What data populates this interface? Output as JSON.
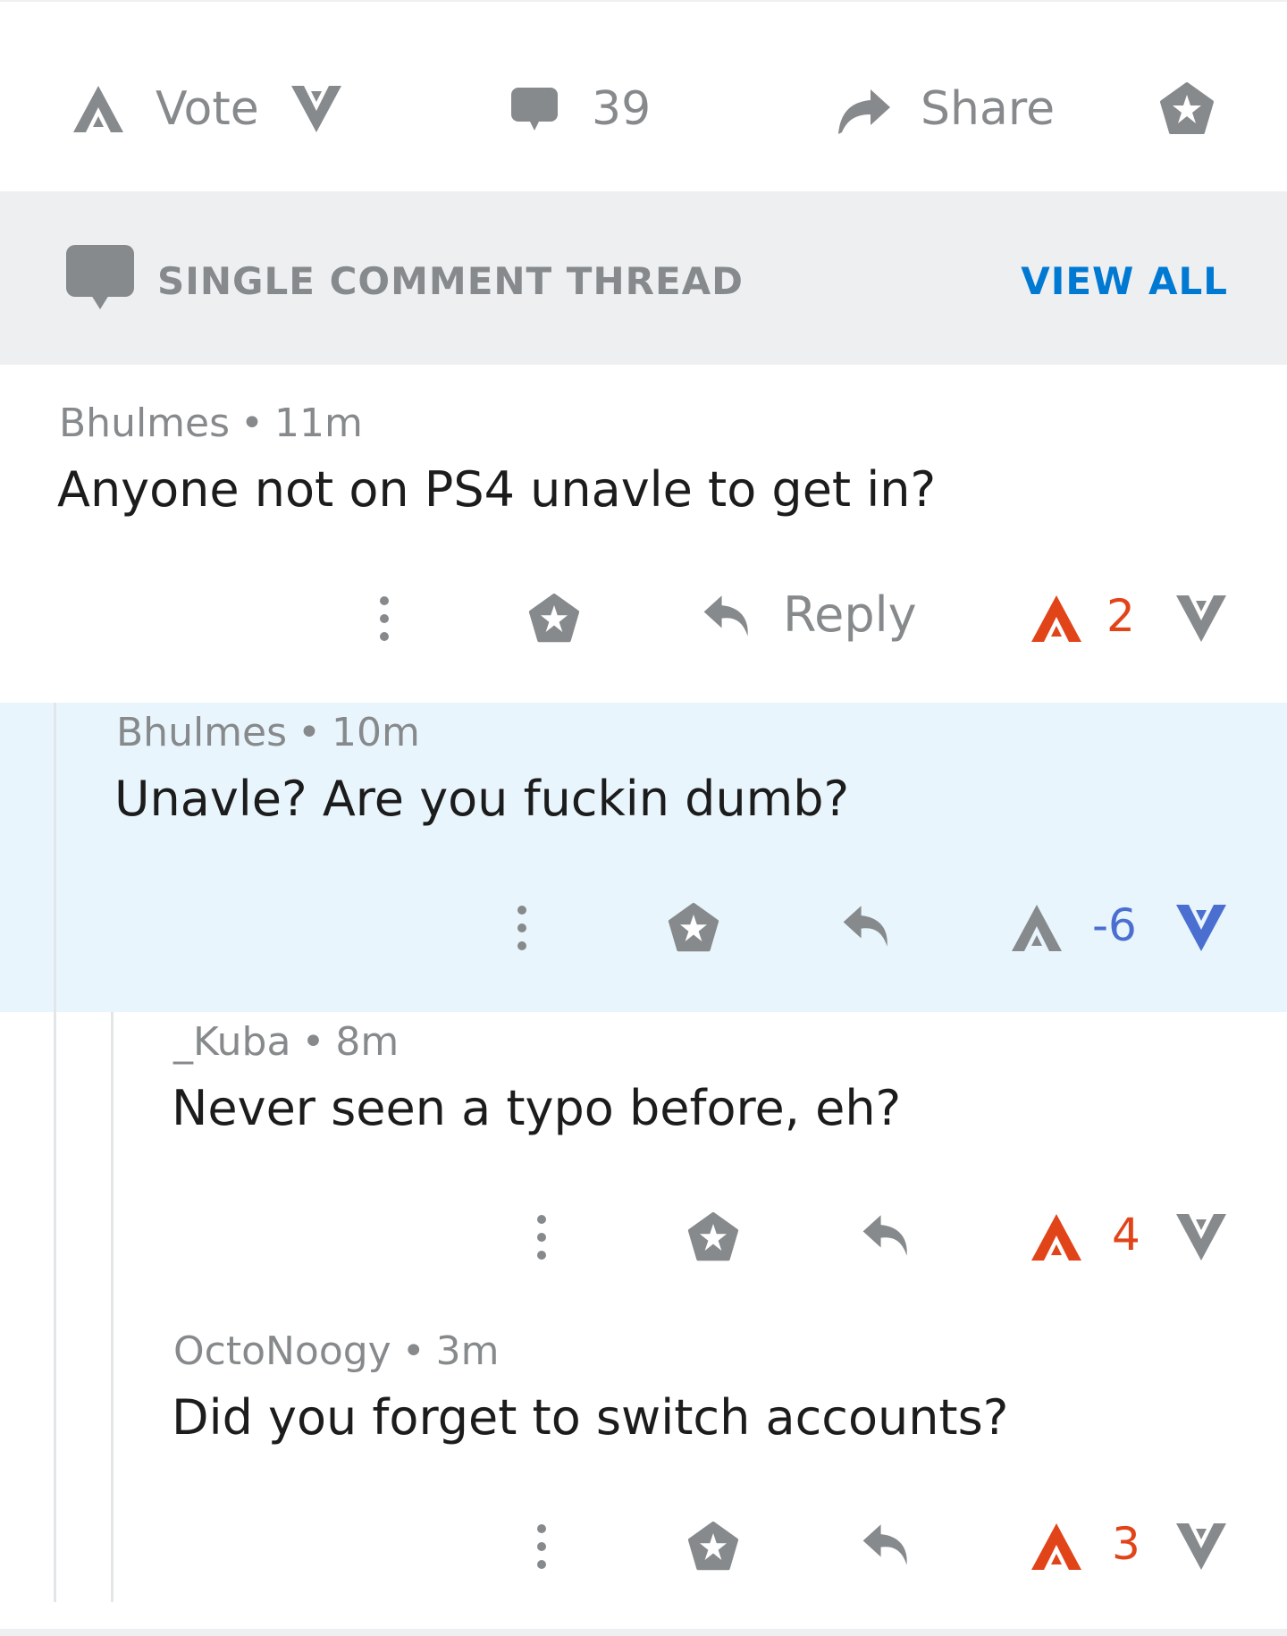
{
  "post_bar": {
    "vote_label": "Vote",
    "comment_count": "39",
    "share_label": "Share"
  },
  "banner": {
    "title": "SINGLE COMMENT THREAD",
    "view_all": "VIEW ALL"
  },
  "comments": [
    {
      "author": "Bhulmes",
      "time": "11m",
      "body": "Anyone not on PS4 unavle to get in?",
      "score": "2",
      "reply_label": "Reply",
      "vote_state": "up"
    },
    {
      "author": "Bhulmes",
      "time": "10m",
      "body": "Unavle? Are you fuckin dumb?",
      "score": "-6",
      "vote_state": "down",
      "highlighted": true
    },
    {
      "author": "_Kuba",
      "time": "8m",
      "body": "Never seen a typo before, eh?",
      "score": "4",
      "vote_state": "up"
    },
    {
      "author": "OctoNoogy",
      "time": "3m",
      "body": "Did you forget to switch accounts?",
      "score": "3",
      "vote_state": "up"
    }
  ],
  "colors": {
    "upvote": "#e2441a",
    "downvote": "#4a6fd1",
    "muted": "#878a8c",
    "link": "#0079d3",
    "highlight_bg": "#e8f5fc"
  },
  "icons": [
    "upvote-icon",
    "downvote-icon",
    "comment-icon",
    "share-icon",
    "award-icon",
    "more-icon",
    "reply-icon"
  ]
}
